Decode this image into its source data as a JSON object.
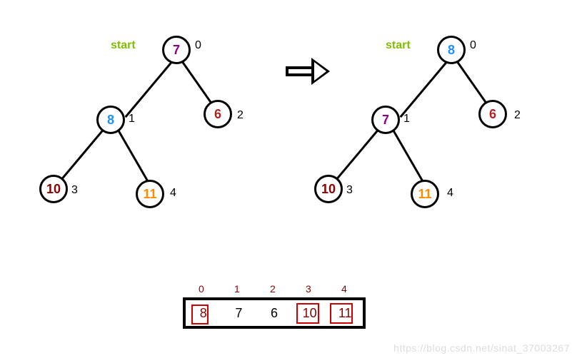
{
  "tree_left": {
    "start_label": "start",
    "nodes": [
      {
        "id": "l0",
        "val": "7",
        "idx": "0",
        "color": "#8B008B"
      },
      {
        "id": "l1",
        "val": "8",
        "idx": "1",
        "color": "#1E90FF"
      },
      {
        "id": "l2",
        "val": "6",
        "idx": "2",
        "color": "#B22222"
      },
      {
        "id": "l3",
        "val": "10",
        "idx": "3",
        "color": "#8B0000"
      },
      {
        "id": "l4",
        "val": "11",
        "idx": "4",
        "color": "#FF8C00"
      }
    ]
  },
  "tree_right": {
    "start_label": "start",
    "nodes": [
      {
        "id": "r0",
        "val": "8",
        "idx": "0",
        "color": "#1E90FF"
      },
      {
        "id": "r1",
        "val": "7",
        "idx": "1",
        "color": "#8B008B"
      },
      {
        "id": "r2",
        "val": "6",
        "idx": "2",
        "color": "#B22222"
      },
      {
        "id": "r3",
        "val": "10",
        "idx": "3",
        "color": "#8B0000"
      },
      {
        "id": "r4",
        "val": "11",
        "idx": "4",
        "color": "#FF8C00"
      }
    ]
  },
  "array": {
    "indices": [
      "0",
      "1",
      "2",
      "3",
      "4"
    ],
    "cells": [
      {
        "val": "8",
        "highlight": true,
        "color": "#8B0000"
      },
      {
        "val": "7",
        "highlight": false,
        "color": "#000"
      },
      {
        "val": "6",
        "highlight": false,
        "color": "#000"
      },
      {
        "val": "10",
        "highlight": true,
        "color": "#8B0000"
      },
      {
        "val": "11",
        "highlight": true,
        "color": "#8B0000"
      }
    ]
  },
  "watermark": "https://blog.csdn.net/sinat_37003267"
}
